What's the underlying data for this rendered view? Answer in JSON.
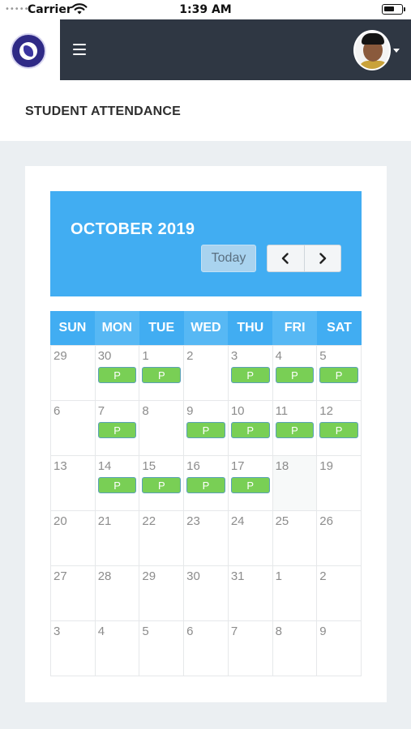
{
  "status_bar": {
    "signal": "•••••",
    "carrier": "Carrier",
    "time": "1:39 AM"
  },
  "header": {
    "menu_icon": "hamburger-icon",
    "logo_icon": "school-logo",
    "avatar_icon": "user-avatar",
    "dropdown_icon": "caret-down-icon"
  },
  "page": {
    "title": "STUDENT ATTENDANCE"
  },
  "calendar": {
    "month_title": "OCTOBER 2019",
    "today_label": "Today",
    "prev_icon": "chevron-left-icon",
    "next_icon": "chevron-right-icon",
    "weekdays": [
      "SUN",
      "MON",
      "TUE",
      "WED",
      "THU",
      "FRI",
      "SAT"
    ],
    "today_date": "18",
    "present_label": "P",
    "weeks": [
      [
        {
          "day": "29",
          "present": false
        },
        {
          "day": "30",
          "present": true
        },
        {
          "day": "1",
          "present": true
        },
        {
          "day": "2",
          "present": false
        },
        {
          "day": "3",
          "present": true
        },
        {
          "day": "4",
          "present": true
        },
        {
          "day": "5",
          "present": true
        }
      ],
      [
        {
          "day": "6",
          "present": false
        },
        {
          "day": "7",
          "present": true
        },
        {
          "day": "8",
          "present": false
        },
        {
          "day": "9",
          "present": true
        },
        {
          "day": "10",
          "present": true
        },
        {
          "day": "11",
          "present": true
        },
        {
          "day": "12",
          "present": true
        }
      ],
      [
        {
          "day": "13",
          "present": false
        },
        {
          "day": "14",
          "present": true
        },
        {
          "day": "15",
          "present": true
        },
        {
          "day": "16",
          "present": true
        },
        {
          "day": "17",
          "present": true
        },
        {
          "day": "18",
          "present": false,
          "today": true
        },
        {
          "day": "19",
          "present": false
        }
      ],
      [
        {
          "day": "20",
          "present": false
        },
        {
          "day": "21",
          "present": false
        },
        {
          "day": "22",
          "present": false
        },
        {
          "day": "23",
          "present": false
        },
        {
          "day": "24",
          "present": false
        },
        {
          "day": "25",
          "present": false
        },
        {
          "day": "26",
          "present": false
        }
      ],
      [
        {
          "day": "27",
          "present": false
        },
        {
          "day": "28",
          "present": false
        },
        {
          "day": "29",
          "present": false
        },
        {
          "day": "30",
          "present": false
        },
        {
          "day": "31",
          "present": false
        },
        {
          "day": "1",
          "present": false
        },
        {
          "day": "2",
          "present": false
        }
      ],
      [
        {
          "day": "3",
          "present": false
        },
        {
          "day": "4",
          "present": false
        },
        {
          "day": "5",
          "present": false
        },
        {
          "day": "6",
          "present": false
        },
        {
          "day": "7",
          "present": false
        },
        {
          "day": "8",
          "present": false
        },
        {
          "day": "9",
          "present": false
        }
      ]
    ],
    "colors": {
      "header_bg": "#41adf2",
      "present_badge": "#79cf55",
      "nav_bar": "#2f3743"
    }
  }
}
